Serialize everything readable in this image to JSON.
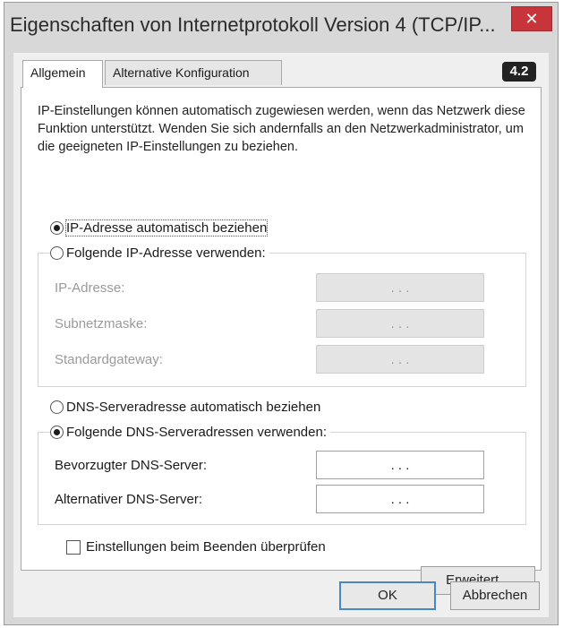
{
  "window": {
    "title": "Eigenschaften von Internetprotokoll Version 4 (TCP/IP...",
    "close_symbol": "✕"
  },
  "tabs": [
    {
      "label": "Allgemein",
      "active": true
    },
    {
      "label": "Alternative Konfiguration",
      "active": false
    }
  ],
  "badge": "4.2",
  "description": "IP-Einstellungen können automatisch zugewiesen werden, wenn das Netzwerk diese Funktion unterstützt. Wenden Sie sich andernfalls an den Netzwerkadministrator, um die geeigneten IP-Einstellungen zu beziehen.",
  "ip": {
    "auto_label": "IP-Adresse automatisch beziehen",
    "auto_selected": true,
    "manual_label": "Folgende IP-Adresse verwenden:",
    "manual_selected": false,
    "fields": [
      {
        "label": "IP-Adresse:",
        "value": ". . ."
      },
      {
        "label": "Subnetzmaske:",
        "value": ". . ."
      },
      {
        "label": "Standardgateway:",
        "value": ". . ."
      }
    ]
  },
  "dns": {
    "auto_label": "DNS-Serveradresse automatisch beziehen",
    "auto_selected": false,
    "manual_label": "Folgende DNS-Serveradressen verwenden:",
    "manual_selected": true,
    "fields": [
      {
        "label": "Bevorzugter DNS-Server:",
        "value": ". . ."
      },
      {
        "label": "Alternativer DNS-Server:",
        "value": ". . ."
      }
    ]
  },
  "validate_label": "Einstellungen beim Beenden überprüfen",
  "validate_checked": false,
  "buttons": {
    "advanced": "Erweitert...",
    "ok": "OK",
    "cancel": "Abbrechen"
  }
}
